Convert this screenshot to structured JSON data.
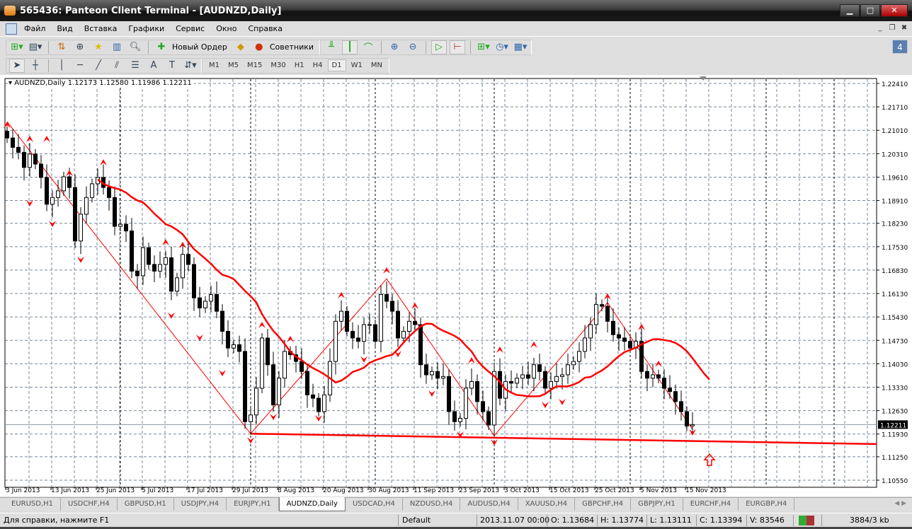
{
  "window": {
    "title": "565436: Panteon Client Terminal - [AUDNZD,Daily]"
  },
  "menu": [
    "Файл",
    "Вид",
    "Вставка",
    "Графики",
    "Сервис",
    "Окно",
    "Справка"
  ],
  "toolbar": {
    "new_order": "Новый Ордер",
    "experts": "Советники",
    "notifications": "4"
  },
  "timeframes": [
    "M1",
    "M5",
    "M15",
    "M30",
    "H1",
    "H4",
    "D1",
    "W1",
    "MN"
  ],
  "active_timeframe": "D1",
  "chart_header": "AUDNZD,Daily  1.12173 1.12580 1.11986 1.12211",
  "tabs": [
    "EURUSD,H1",
    "USDCHF,H4",
    "GBPUSD,H1",
    "USDJPY,H4",
    "EURJPY,H1",
    "AUDNZD,Daily",
    "USDCAD,H4",
    "NZDUSD,H4",
    "AUDUSD,H4",
    "XAUUSD,H4",
    "GBPCHF,H4",
    "GBPJPY,H1",
    "EURCHF,H4",
    "EURGBP,H4"
  ],
  "active_tab": "AUDNZD,Daily",
  "status": {
    "help": "Для справки, нажмите F1",
    "profile": "Default",
    "time": "2013.11.07 00:00",
    "open": "O: 1.13684",
    "high": "H: 1.13774",
    "low": "L: 1.13111",
    "close": "C: 1.13394",
    "volume": "V: 83546",
    "traffic": "3884/3 kb"
  },
  "colors": {
    "candle": "#000000",
    "ma": "#ff0000",
    "zigzag": "#ff0000",
    "grid": "#778899"
  },
  "chart_data": {
    "type": "candlestick",
    "symbol": "AUDNZD",
    "period": "Daily",
    "last_ohlc": [
      1.12173,
      1.1258,
      1.11986,
      1.12211
    ],
    "current_price": "1.12211",
    "ylim": [
      1.1055,
      1.2241
    ],
    "price_ticks": [
      "1.22410",
      "1.21710",
      "1.21010",
      "1.20310",
      "1.19610",
      "1.18910",
      "1.18230",
      "1.17530",
      "1.16830",
      "1.16130",
      "1.15430",
      "1.14730",
      "1.14030",
      "1.13330",
      "1.12630",
      "1.11930",
      "1.11250",
      "1.10550"
    ],
    "date_labels": [
      "3 Jun 2013",
      "13 Jun 2013",
      "25 Jun 2013",
      "5 Jul 2013",
      "17 Jul 2013",
      "29 Jul 2013",
      "8 Aug 2013",
      "20 Aug 2013",
      "30 Aug 2013",
      "11 Sep 2013",
      "23 Sep 2013",
      "3 Oct 2013",
      "15 Oct 2013",
      "25 Oct 2013",
      "5 Nov 2013",
      "15 Nov 2013"
    ],
    "closes": [
      1.2078,
      1.205,
      1.2035,
      1.199,
      1.203,
      1.2,
      1.196,
      1.188,
      1.19,
      1.192,
      1.1962,
      1.193,
      1.177,
      1.185,
      1.19,
      1.1941,
      1.196,
      1.193,
      1.19,
      1.1814,
      1.182,
      1.18,
      1.168,
      1.1666,
      1.175,
      1.17,
      1.168,
      1.17,
      1.172,
      1.162,
      1.166,
      1.173,
      1.17,
      1.16,
      1.157,
      1.159,
      1.161,
      1.156,
      1.15,
      1.145,
      1.146,
      1.144,
      1.123,
      1.125,
      1.133,
      1.148,
      1.14,
      1.128,
      1.136,
      1.144,
      1.143,
      1.141,
      1.138,
      1.131,
      1.13,
      1.126,
      1.131,
      1.141,
      1.153,
      1.156,
      1.15,
      1.148,
      1.147,
      1.152,
      1.152,
      1.147,
      1.161,
      1.159,
      1.156,
      1.148,
      1.15,
      1.153,
      1.152,
      1.14,
      1.137,
      1.138,
      1.136,
      1.1365,
      1.126,
      1.123,
      1.124,
      1.133,
      1.135,
      1.129,
      1.126,
      1.122,
      1.138,
      1.13,
      1.135,
      1.1345,
      1.136,
      1.137,
      1.136,
      1.14,
      1.138,
      1.133,
      1.135,
      1.1365,
      1.137,
      1.14,
      1.141,
      1.144,
      1.148,
      1.152,
      1.158,
      1.1575,
      1.153,
      1.149,
      1.148,
      1.147,
      1.145,
      1.147,
      1.138,
      1.136,
      1.137,
      1.136,
      1.133,
      1.132,
      1.129,
      1.126,
      1.1217,
      1.12211
    ],
    "period_separators": [
      20,
      43,
      65,
      86,
      110,
      134,
      146
    ],
    "zigzag": [
      [
        0,
        1.2127
      ],
      [
        43,
        1.1194
      ],
      [
        67,
        1.1657
      ],
      [
        86,
        1.1188
      ],
      [
        106,
        1.1586
      ],
      [
        121,
        1.1207
      ]
    ],
    "support_line": [
      [
        43,
        1.1194
      ],
      [
        157,
        1.1163
      ]
    ],
    "fractals_up": [
      [
        0,
        1.2116
      ],
      [
        4,
        1.2074
      ],
      [
        7,
        1.2074
      ],
      [
        11,
        1.1972
      ],
      [
        17,
        1.2004
      ],
      [
        28,
        1.1765
      ],
      [
        31,
        1.1757
      ],
      [
        45,
        1.1518
      ],
      [
        50,
        1.1476
      ],
      [
        59,
        1.1607
      ],
      [
        67,
        1.1681
      ],
      [
        72,
        1.1575
      ],
      [
        82,
        1.1412
      ],
      [
        87,
        1.1444
      ],
      [
        93,
        1.1459
      ],
      [
        106,
        1.1603
      ],
      [
        112,
        1.1512
      ],
      [
        115,
        1.1402
      ]
    ],
    "fractals_down": [
      [
        4,
        1.1884
      ],
      [
        8,
        1.1822
      ],
      [
        13,
        1.1715
      ],
      [
        29,
        1.1548
      ],
      [
        34,
        1.1482
      ],
      [
        38,
        1.1376
      ],
      [
        43,
        1.1175
      ],
      [
        47,
        1.1245
      ],
      [
        55,
        1.1241
      ],
      [
        63,
        1.1417
      ],
      [
        69,
        1.1433
      ],
      [
        75,
        1.1315
      ],
      [
        80,
        1.1192
      ],
      [
        86,
        1.1169
      ],
      [
        95,
        1.1281
      ],
      [
        98,
        1.129
      ],
      [
        121,
        1.1199
      ]
    ],
    "signal_arrow": [
      124,
      1.1116
    ],
    "ma_period": 14
  }
}
